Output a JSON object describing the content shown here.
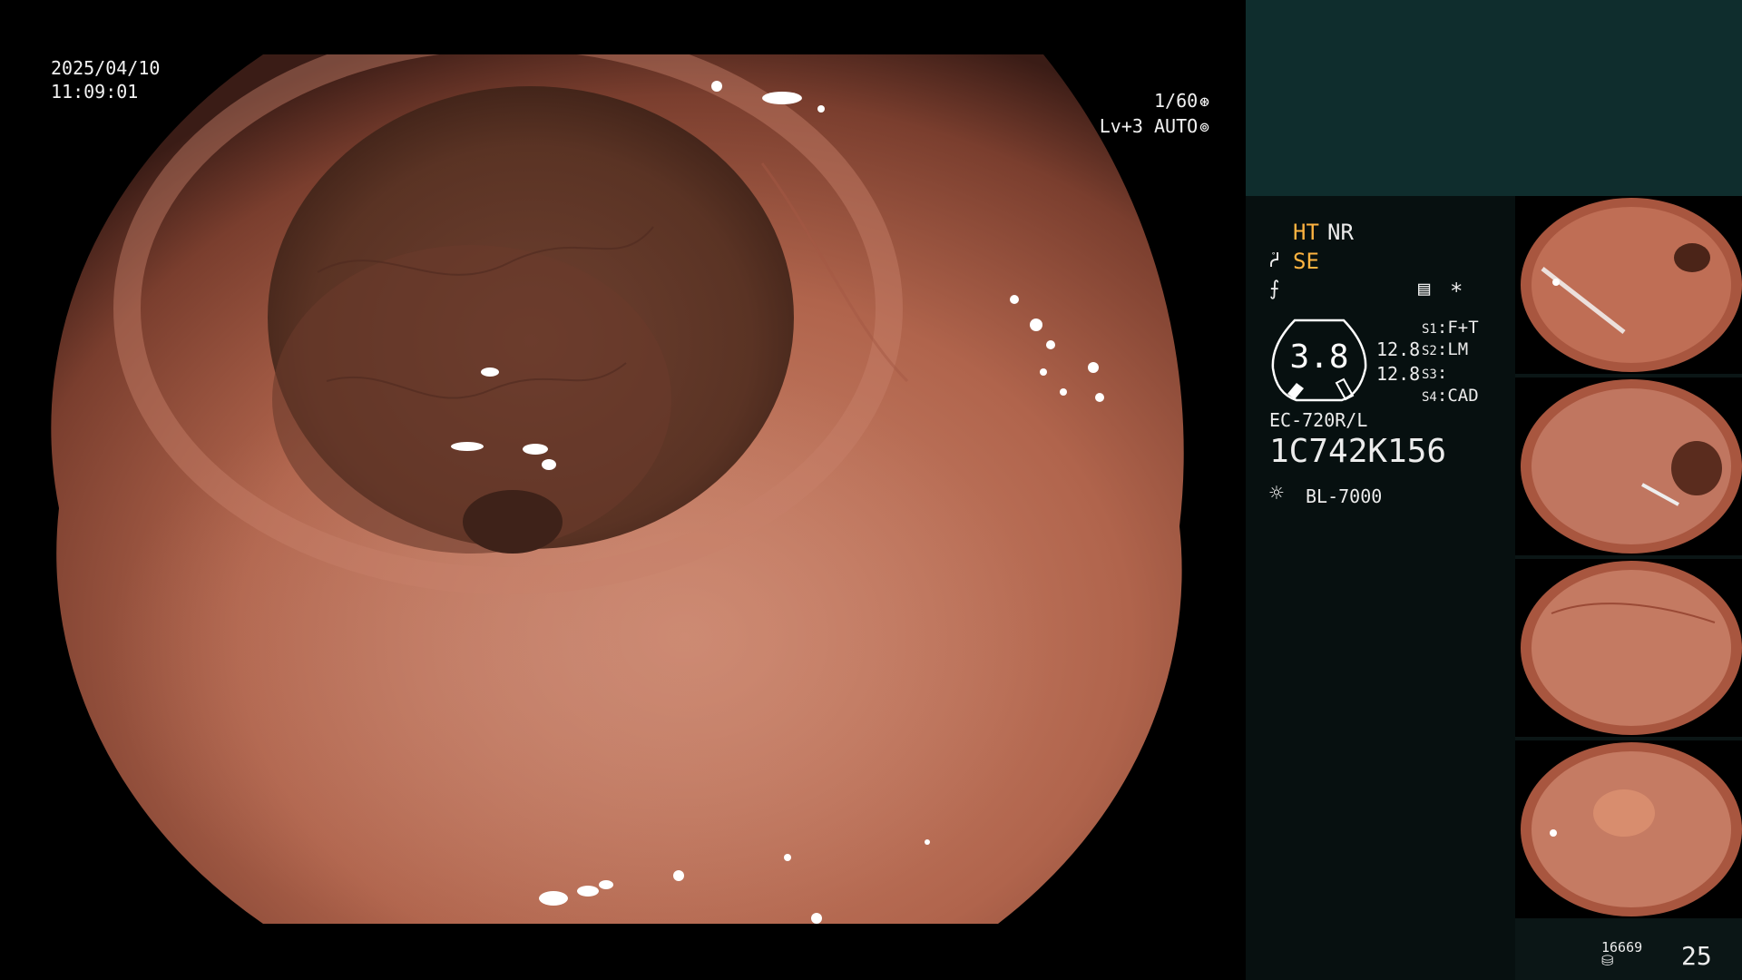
{
  "view": {
    "date": "2025/04/10",
    "time": "11:09:01",
    "shutter": "1/60",
    "shutter_icon": "aperture-icon",
    "level": "Lv+3",
    "iris_mode": "AUTO",
    "iris_icon": "iris-icon"
  },
  "panel": {
    "mode_ht": "HT",
    "mode_nr": "NR",
    "mode_se": "SE",
    "se_icon": "enhance-icon",
    "freeze_icon": "freeze-icon",
    "menu_icon": "menu-icon",
    "asterisk": "*",
    "zoom_value": "3.8",
    "zoom_mark_1": "12.8",
    "zoom_mark_2": "12.8",
    "switches": [
      {
        "key": "S1",
        "value": "F+T"
      },
      {
        "key": "S2",
        "value": "LM"
      },
      {
        "key": "S3",
        "value": ""
      },
      {
        "key": "S4",
        "value": "CAD"
      }
    ],
    "scope_model": "EC-720R/L",
    "scope_serial": "1C742K156",
    "light_source": "BL-7000",
    "storage_count": "16669",
    "image_count": "25"
  },
  "colors": {
    "panel_top": "#0f2d2d",
    "panel_bg": "#071010",
    "accent_orange": "#ffb340",
    "mucosa": "#b86850"
  }
}
